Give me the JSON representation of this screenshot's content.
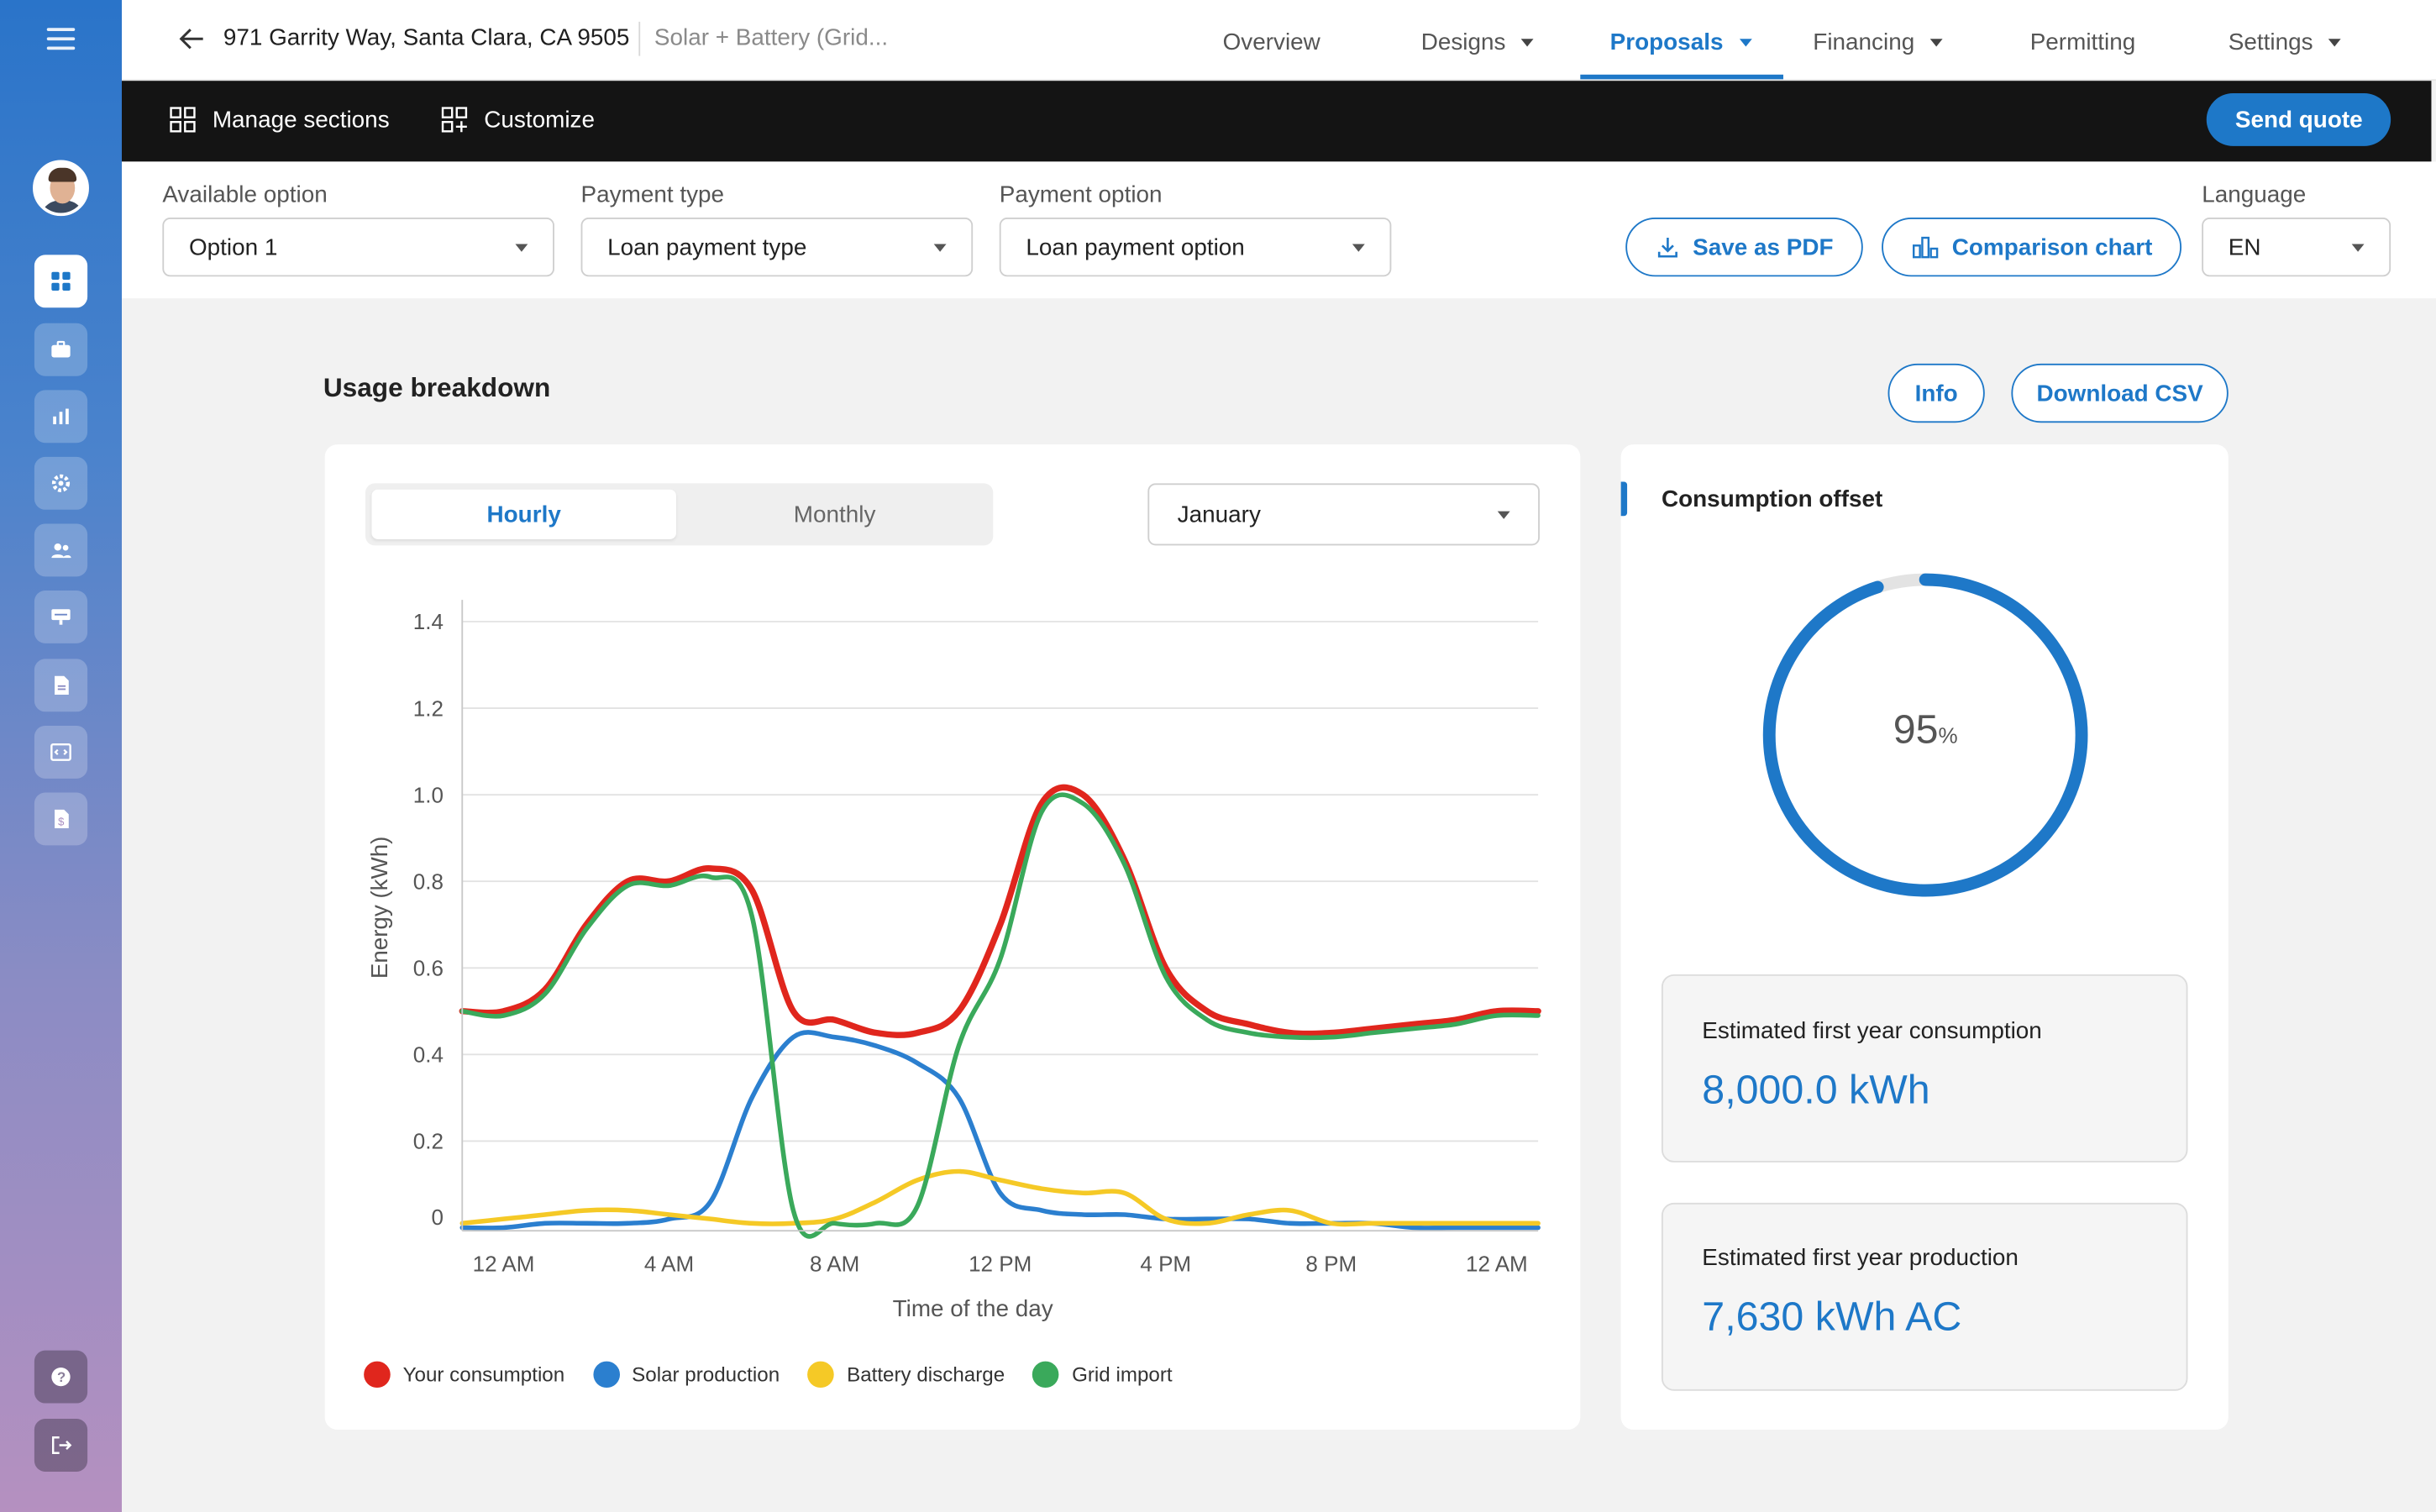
{
  "colors": {
    "accent": "#1e78c8",
    "consumption": "#e0261d",
    "solar": "#2b7fcf",
    "battery": "#f5c926",
    "grid": "#3aa95b"
  },
  "header": {
    "address": "971 Garrity Way, Santa Clara, CA 9505",
    "project": "Solar + Battery (Grid...",
    "nav": [
      {
        "label": "Overview",
        "has_caret": false
      },
      {
        "label": "Designs",
        "has_caret": true
      },
      {
        "label": "Proposals",
        "has_caret": true,
        "active": true
      },
      {
        "label": "Financing",
        "has_caret": true
      },
      {
        "label": "Permitting",
        "has_caret": false
      },
      {
        "label": "Settings",
        "has_caret": true
      }
    ]
  },
  "toolbar": {
    "manage_sections": "Manage sections",
    "customize": "Customize",
    "send_quote": "Send quote"
  },
  "options": {
    "available_option_label": "Available option",
    "available_option_value": "Option 1",
    "payment_type_label": "Payment type",
    "payment_type_value": "Loan payment type",
    "payment_option_label": "Payment option",
    "payment_option_value": "Loan payment option",
    "save_pdf": "Save as PDF",
    "comparison_chart": "Comparison chart",
    "language_label": "Language",
    "language_value": "EN"
  },
  "usage": {
    "title": "Usage breakdown",
    "info_button": "Info",
    "download_csv": "Download CSV",
    "tab_hourly": "Hourly",
    "tab_monthly": "Monthly",
    "month": "January"
  },
  "chart_data": {
    "type": "line",
    "xlabel": "Time of the day",
    "ylabel": "Energy (kWh)",
    "ylim": [
      0,
      1.4
    ],
    "yticks": [
      "0",
      "0.2",
      "0.4",
      "0.6",
      "0.8",
      "1.0",
      "1.2",
      "1.4"
    ],
    "xtick_labels": [
      "12 AM",
      "4 AM",
      "8 AM",
      "12 PM",
      "4 PM",
      "8 PM",
      "12 AM"
    ],
    "xlim": [
      0,
      26
    ],
    "grid": true,
    "legend_position": "bottom-left",
    "series": [
      {
        "name": "Your consumption",
        "color": "#e0261d",
        "x": [
          0,
          1,
          2,
          3,
          4,
          5,
          6,
          7,
          8,
          9,
          10,
          11,
          12,
          13,
          14,
          15,
          16,
          17,
          18,
          19,
          20,
          21,
          22,
          23,
          24,
          25,
          26
        ],
        "y": [
          0.5,
          0.5,
          0.55,
          0.7,
          0.8,
          0.8,
          0.83,
          0.78,
          0.5,
          0.48,
          0.45,
          0.45,
          0.5,
          0.7,
          0.98,
          1.0,
          0.85,
          0.6,
          0.5,
          0.47,
          0.45,
          0.45,
          0.46,
          0.47,
          0.48,
          0.5,
          0.5
        ]
      },
      {
        "name": "Solar production",
        "color": "#2b7fcf",
        "x": [
          0,
          1,
          2,
          3,
          4,
          5,
          6,
          7,
          8,
          9,
          10,
          11,
          12,
          13,
          14,
          15,
          16,
          17,
          18,
          19,
          20,
          21,
          22,
          23,
          24,
          25,
          26
        ],
        "y": [
          0,
          0,
          0.01,
          0.01,
          0.01,
          0.02,
          0.06,
          0.3,
          0.44,
          0.44,
          0.42,
          0.38,
          0.3,
          0.08,
          0.04,
          0.03,
          0.03,
          0.02,
          0.02,
          0.02,
          0.01,
          0.01,
          0.01,
          0,
          0,
          0,
          0
        ]
      },
      {
        "name": "Battery discharge",
        "color": "#f5c926",
        "x": [
          0,
          1,
          2,
          3,
          4,
          5,
          6,
          7,
          8,
          9,
          10,
          11,
          12,
          13,
          14,
          15,
          16,
          17,
          18,
          19,
          20,
          21,
          22,
          23,
          24,
          25,
          26
        ],
        "y": [
          0.01,
          0.02,
          0.03,
          0.04,
          0.04,
          0.03,
          0.02,
          0.01,
          0.01,
          0.02,
          0.06,
          0.11,
          0.13,
          0.11,
          0.09,
          0.08,
          0.08,
          0.02,
          0.01,
          0.03,
          0.04,
          0.01,
          0.01,
          0.01,
          0.01,
          0.01,
          0.01
        ]
      },
      {
        "name": "Grid import",
        "color": "#3aa95b",
        "x": [
          0,
          1,
          2,
          3,
          4,
          5,
          6,
          7,
          8,
          9,
          10,
          11,
          12,
          13,
          14,
          15,
          16,
          17,
          18,
          19,
          20,
          21,
          22,
          23,
          24,
          25,
          26
        ],
        "y": [
          0.5,
          0.49,
          0.54,
          0.69,
          0.79,
          0.79,
          0.81,
          0.72,
          0.04,
          0.01,
          0.01,
          0.05,
          0.42,
          0.62,
          0.96,
          0.98,
          0.84,
          0.58,
          0.48,
          0.45,
          0.44,
          0.44,
          0.45,
          0.46,
          0.47,
          0.49,
          0.49
        ]
      }
    ]
  },
  "offset": {
    "title": "Consumption offset",
    "percent": 95,
    "percent_number": "95",
    "percent_sign": "%",
    "consumption_label": "Estimated first year consumption",
    "consumption_value": "8,000.0 kWh",
    "production_label": "Estimated first year production",
    "production_value": "7,630 kWh AC"
  }
}
